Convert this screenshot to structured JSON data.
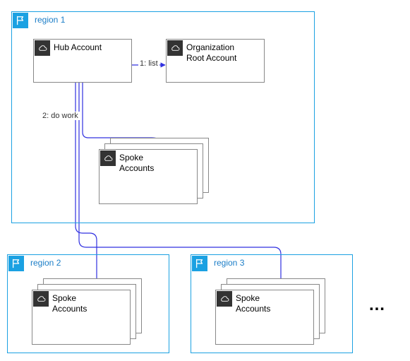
{
  "regions": {
    "r1": {
      "label": "region 1"
    },
    "r2": {
      "label": "region 2"
    },
    "r3": {
      "label": "region 3"
    }
  },
  "nodes": {
    "hub": {
      "label": "Hub Account"
    },
    "org": {
      "label": "Organization\nRoot Account"
    },
    "spoke1": {
      "label": "Spoke\nAccounts"
    },
    "spoke2": {
      "label": "Spoke\nAccounts"
    },
    "spoke3": {
      "label": "Spoke\nAccounts"
    }
  },
  "edges": {
    "e1": {
      "label": "1: list"
    },
    "e2": {
      "label": "2: do work"
    }
  },
  "ellipsis": "…",
  "colors": {
    "region_border": "#1ba1e2",
    "connector": "#3030e0"
  }
}
